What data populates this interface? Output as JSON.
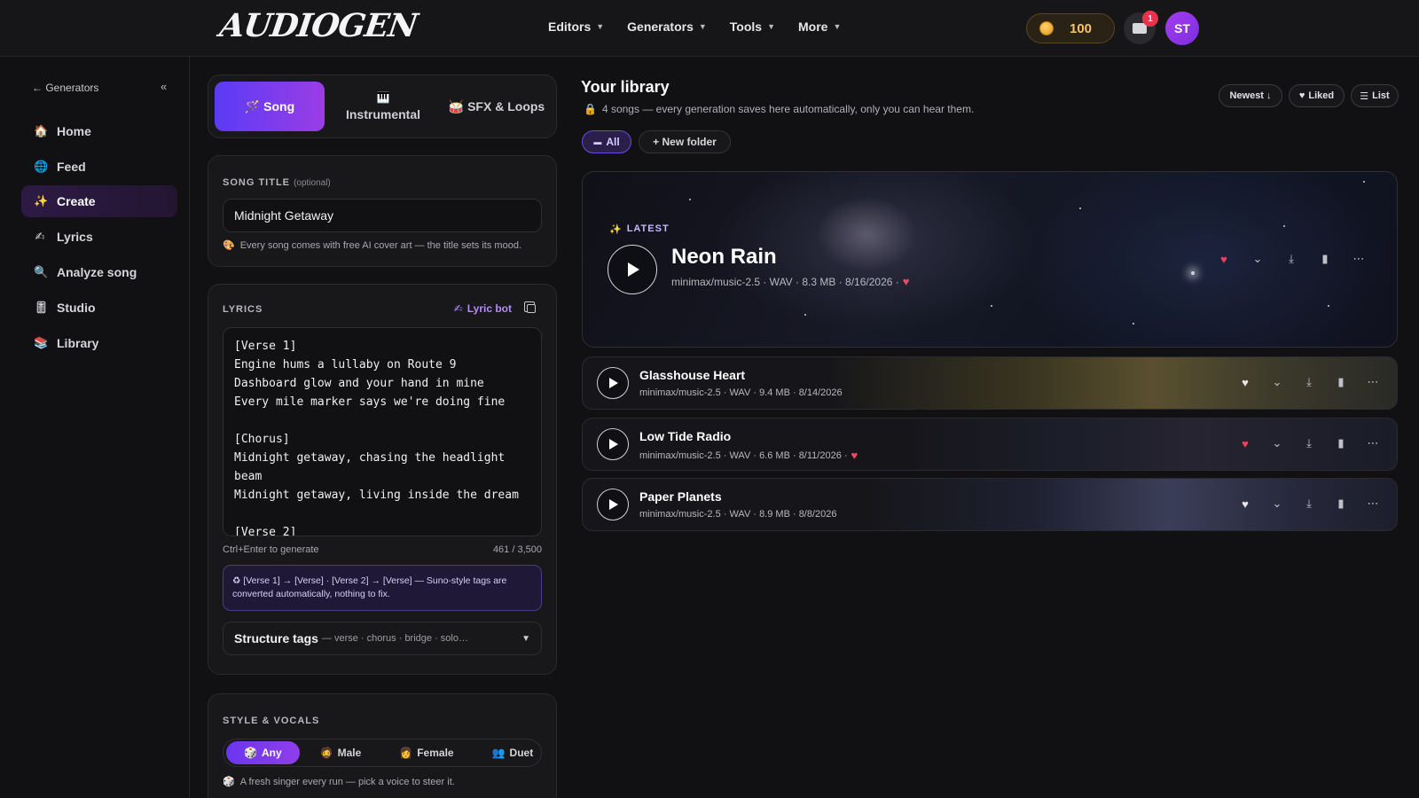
{
  "app": {
    "logo": "AUDIOGEN"
  },
  "nav": [
    "Editors",
    "Generators",
    "Tools",
    "More"
  ],
  "header": {
    "credits": "100",
    "notification_count": "1",
    "avatar_initials": "ST"
  },
  "sidebar": {
    "back_label": "← Generators",
    "collapse": "«",
    "items": [
      {
        "label": "Home",
        "icon": "🏠"
      },
      {
        "label": "Feed",
        "icon": "🌐"
      },
      {
        "label": "Create",
        "icon": "✨"
      },
      {
        "label": "Lyrics",
        "icon": "✍"
      },
      {
        "label": "Analyze song",
        "icon": "🔍"
      },
      {
        "label": "Studio",
        "icon": "🎚"
      },
      {
        "label": "Library",
        "icon": "📚"
      }
    ],
    "active": "Create"
  },
  "compose": {
    "tabs": [
      {
        "label": "Song",
        "icon": "🪄"
      },
      {
        "label": "Instrumental",
        "icon": "🎹"
      },
      {
        "label": "SFX & Loops",
        "icon": "🥁"
      }
    ],
    "song_title_label": "SONG TITLE",
    "song_title_optional": "(optional)",
    "song_title_value": "Midnight Getaway",
    "song_title_hint": "Every song comes with free AI cover art — the title sets its mood.",
    "lyrics_label": "LYRICS",
    "lyric_bot": "Lyric bot",
    "lyrics_value": "[Verse 1]\nEngine hums a lullaby on Route 9\nDashboard glow and your hand in mine\nEvery mile marker says we're doing fine\n\n[Chorus]\nMidnight getaway, chasing the headlight beam\nMidnight getaway, living inside the dream\n\n[Verse 2]",
    "shortcut_hint": "Ctrl+Enter to generate",
    "char_count": "461 / 3,500",
    "notice": "♻ [Verse 1] → [Verse] · [Verse 2] → [Verse] — Suno-style tags are converted automatically, nothing to fix.",
    "structure_title": "Structure tags",
    "structure_sub": "— verse · chorus · bridge · solo…",
    "style_label": "STYLE & VOCALS",
    "voices": [
      {
        "label": "Any",
        "icon": "🎲"
      },
      {
        "label": "Male",
        "icon": "🧔"
      },
      {
        "label": "Female",
        "icon": "👩"
      },
      {
        "label": "Duet",
        "icon": "👥"
      }
    ],
    "voice_hint": "A fresh singer every run — pick a voice to steer it."
  },
  "library": {
    "title": "Your library",
    "subtitle": "4 songs — every generation saves here automatically, only you can hear them.",
    "sort": "Newest ↓",
    "liked": "Liked",
    "list": "List",
    "filter_all": "All",
    "new_folder": "+ New folder",
    "latest_label": "LATEST",
    "songs": [
      {
        "title": "Neon Rain",
        "meta": "minimax/music-2.5 · WAV · 8.3 MB · 8/16/2026 ·",
        "liked": true
      },
      {
        "title": "Glasshouse Heart",
        "meta": "minimax/music-2.5 · WAV · 9.4 MB · 8/14/2026",
        "liked": false
      },
      {
        "title": "Low Tide Radio",
        "meta": "minimax/music-2.5 · WAV · 6.6 MB · 8/11/2026 ·",
        "liked": true
      },
      {
        "title": "Paper Planets",
        "meta": "minimax/music-2.5 · WAV · 8.9 MB · 8/8/2026",
        "liked": false
      }
    ]
  },
  "colors": {
    "accent": "#7a3ef0",
    "heart": "#f0405c",
    "coin": "#f5c46a"
  }
}
